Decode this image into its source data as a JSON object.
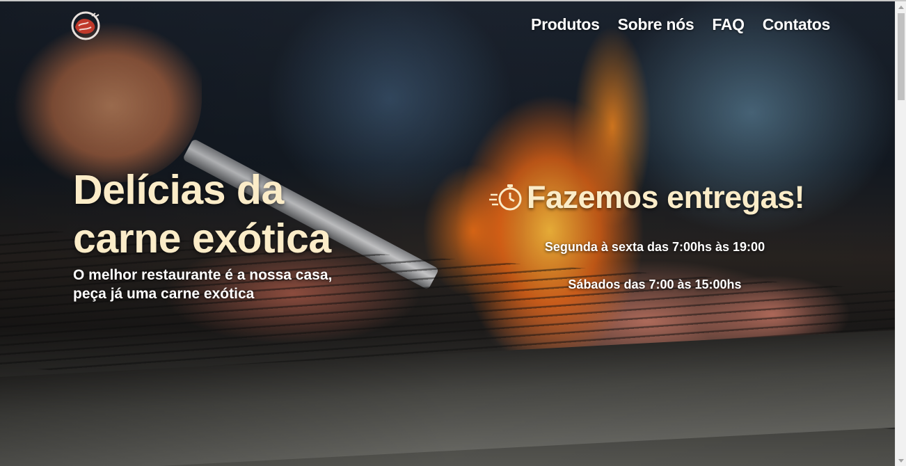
{
  "header": {
    "logo_icon": "meat-logo-icon",
    "nav": [
      {
        "label": "Produtos"
      },
      {
        "label": "Sobre nós"
      },
      {
        "label": "FAQ"
      },
      {
        "label": "Contatos"
      }
    ]
  },
  "hero": {
    "title_line1": "Delícias da",
    "title_line2": "carne exótica",
    "subtitle": "O melhor restaurante é a nossa casa, peça já uma carne exótica"
  },
  "delivery": {
    "icon": "fast-clock-icon",
    "title": "Fazemos entregas!",
    "hours_weekday": "Segunda à sexta das 7:00hs às 19:00",
    "hours_saturday": "Sábados das 7:00 às 15:00hs"
  },
  "colors": {
    "title_cream": "#fbecc8",
    "text_white": "#ffffff",
    "logo_red": "#c0392b"
  }
}
